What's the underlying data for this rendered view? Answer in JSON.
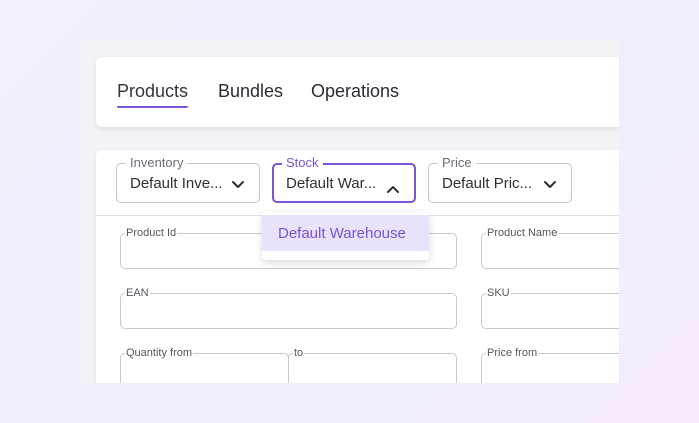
{
  "tabs": [
    {
      "label": "Products",
      "active": true
    },
    {
      "label": "Bundles",
      "active": false
    },
    {
      "label": "Operations",
      "active": false
    }
  ],
  "filters": {
    "inventory": {
      "label": "Inventory",
      "value": "Default Inve..."
    },
    "stock": {
      "label": "Stock",
      "value": "Default War...",
      "open": true
    },
    "price": {
      "label": "Price",
      "value": "Default Pric..."
    }
  },
  "stock_dropdown": {
    "options": [
      "Default Warehouse"
    ],
    "selected": "Default Warehouse"
  },
  "fields": {
    "product_id": "Product Id",
    "product_name": "Product Name",
    "ean": "EAN",
    "sku": "SKU",
    "quantity_from": "Quantity from",
    "quantity_to": "to",
    "price_from": "Price from"
  },
  "colors": {
    "accent": "#7b53d6",
    "option_highlight": "#e8e2fb"
  },
  "icons": {
    "select_closed": "chevron-down-icon",
    "select_open": "chevron-up-icon"
  }
}
